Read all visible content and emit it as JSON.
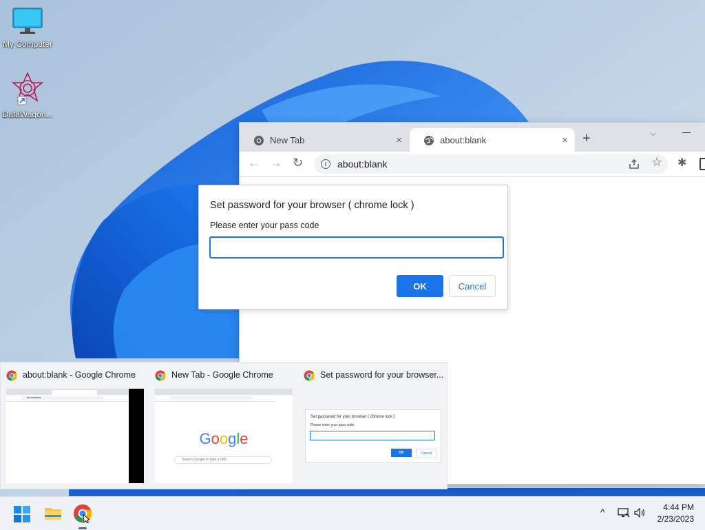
{
  "desktop": {
    "icons": [
      {
        "label": "My Computer",
        "icon": "monitor-icon"
      },
      {
        "label": "DataWagon...",
        "icon": "datawagon-shortcut-icon"
      }
    ]
  },
  "browser": {
    "tabs": [
      {
        "title": "New Tab",
        "icon": "chrome-icon",
        "close": "×"
      },
      {
        "title": "about:blank",
        "icon": "globe-icon",
        "close": "×"
      }
    ],
    "new_tab": "+",
    "tab_search": "⌵",
    "address": "about:blank",
    "nav": {
      "back": "←",
      "forward": "→",
      "reload": "↻"
    },
    "star": "☆",
    "extensions": "✱"
  },
  "dialog": {
    "title": "Set password for your browser ( chrome lock )",
    "message": "Please enter your pass code",
    "input_value": "",
    "ok_label": "OK",
    "cancel_label": "Cancel"
  },
  "thumbnails": [
    {
      "title": "about:blank - Google Chrome",
      "address": "about:blank"
    },
    {
      "title": "New Tab - Google Chrome",
      "logo": "Google",
      "search_placeholder": "Search Google or type a URL"
    },
    {
      "title": "Set password for your browser...",
      "dlg_title": "Set password for your browser ( chrome lock )",
      "dlg_message": "Please enter your pass code",
      "ok": "OK",
      "cancel": "Cancel"
    }
  ],
  "taskbar": {
    "apps": [
      "windows-start-icon",
      "file-explorer-icon",
      "chrome-icon"
    ],
    "tray_chevron": "^",
    "time": "4:44 PM",
    "date": "2/23/2023"
  },
  "colors": {
    "accent": "#1a73e8",
    "wallpaper_blue": "#1f6fe0"
  }
}
